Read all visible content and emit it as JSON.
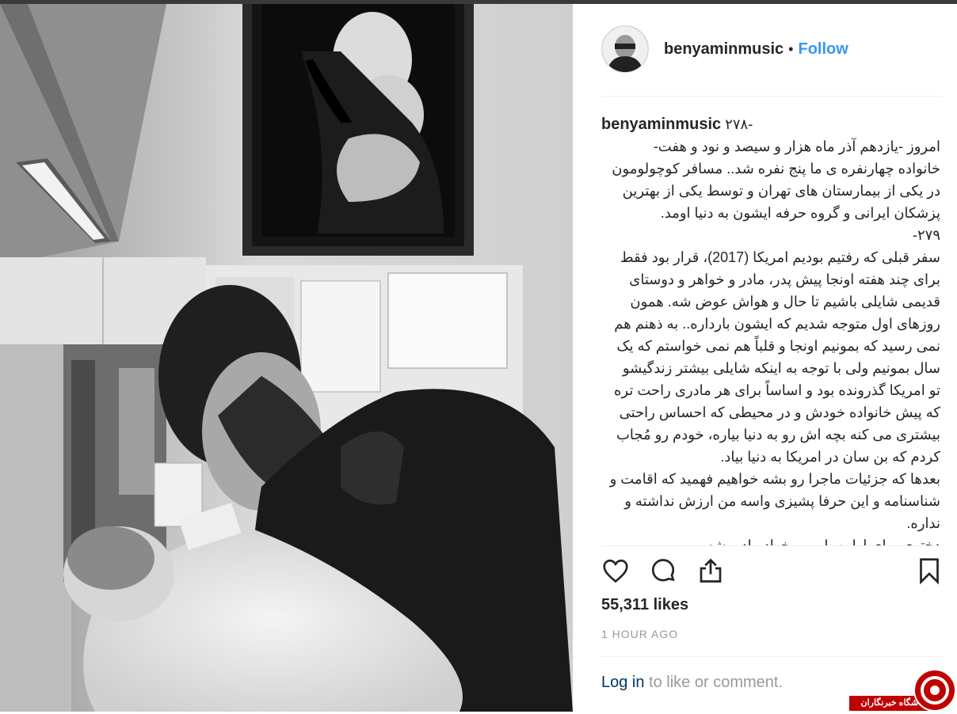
{
  "post": {
    "username": "benyaminmusic",
    "separator": "•",
    "follow_label": "Follow",
    "caption_username": "benyaminmusic",
    "caption_first": "۲۷۸-",
    "caption_lines": [
      "امروز -یازدهم آذر ماه هزار و سیصد و نود و هفت-",
      "خانواده چهارنفره ی ما پنج نفره شد.. مسافر کوچولومون",
      "در یکی از بیمارستان های تهران و توسط یکی از بهترین",
      "پزشکان ایرانی و گروه حرفه ایشون به دنیا اومد.",
      "۲۷۹-",
      "سفر قبلی که رفتیم بودیم امریکا (2017)، قرار بود فقط",
      "برای چند هفته اونجا پیش پدر، مادر و خواهر و دوستای",
      "قدیمی شایلی باشیم تا حال و هواش عوض شه. همون",
      "روزهای اول متوجه شدیم که ایشون بارداره.. به ذهنم هم",
      "نمی رسید که بمونیم اونجا و قلباً هم نمی خواستم که یک",
      "سال بمونیم ولی با توجه به اینکه شایلی بیشتر زندگیشو",
      "تو امریکا گذرونده بود و اساساً برای هر مادری راحت تره",
      "که پیش خانواده خودش و در محیطی که احساس راحتی",
      "بیشتری می کنه بچه اش رو به دنیا بیاره، خودم رو مُجاب",
      "کردم که بن سان در امریکا به دنیا بیاد.",
      "بعدها که جزئیات ماجرا رو بشه خواهیم فهمید که اقامت و",
      "شناسنامه و این حرفا پشیزی واسه من ارزش نداشته و",
      "نداره.",
      "دختری برای اولین بار می خواد مادر بشه"
    ],
    "likes": "55,311 likes",
    "time": "1 HOUR AGO",
    "login_link": "Log in",
    "login_rest": " to like or comment."
  },
  "icons": {
    "like": "heart-icon",
    "comment": "comment-icon",
    "share": "share-icon",
    "save": "bookmark-icon"
  },
  "colors": {
    "accent": "#3897f0",
    "text": "#262626",
    "muted": "#999999",
    "link": "#003569",
    "watermark": "#c00000"
  },
  "watermark": {
    "text": "باشگاه خبرنگاران"
  }
}
